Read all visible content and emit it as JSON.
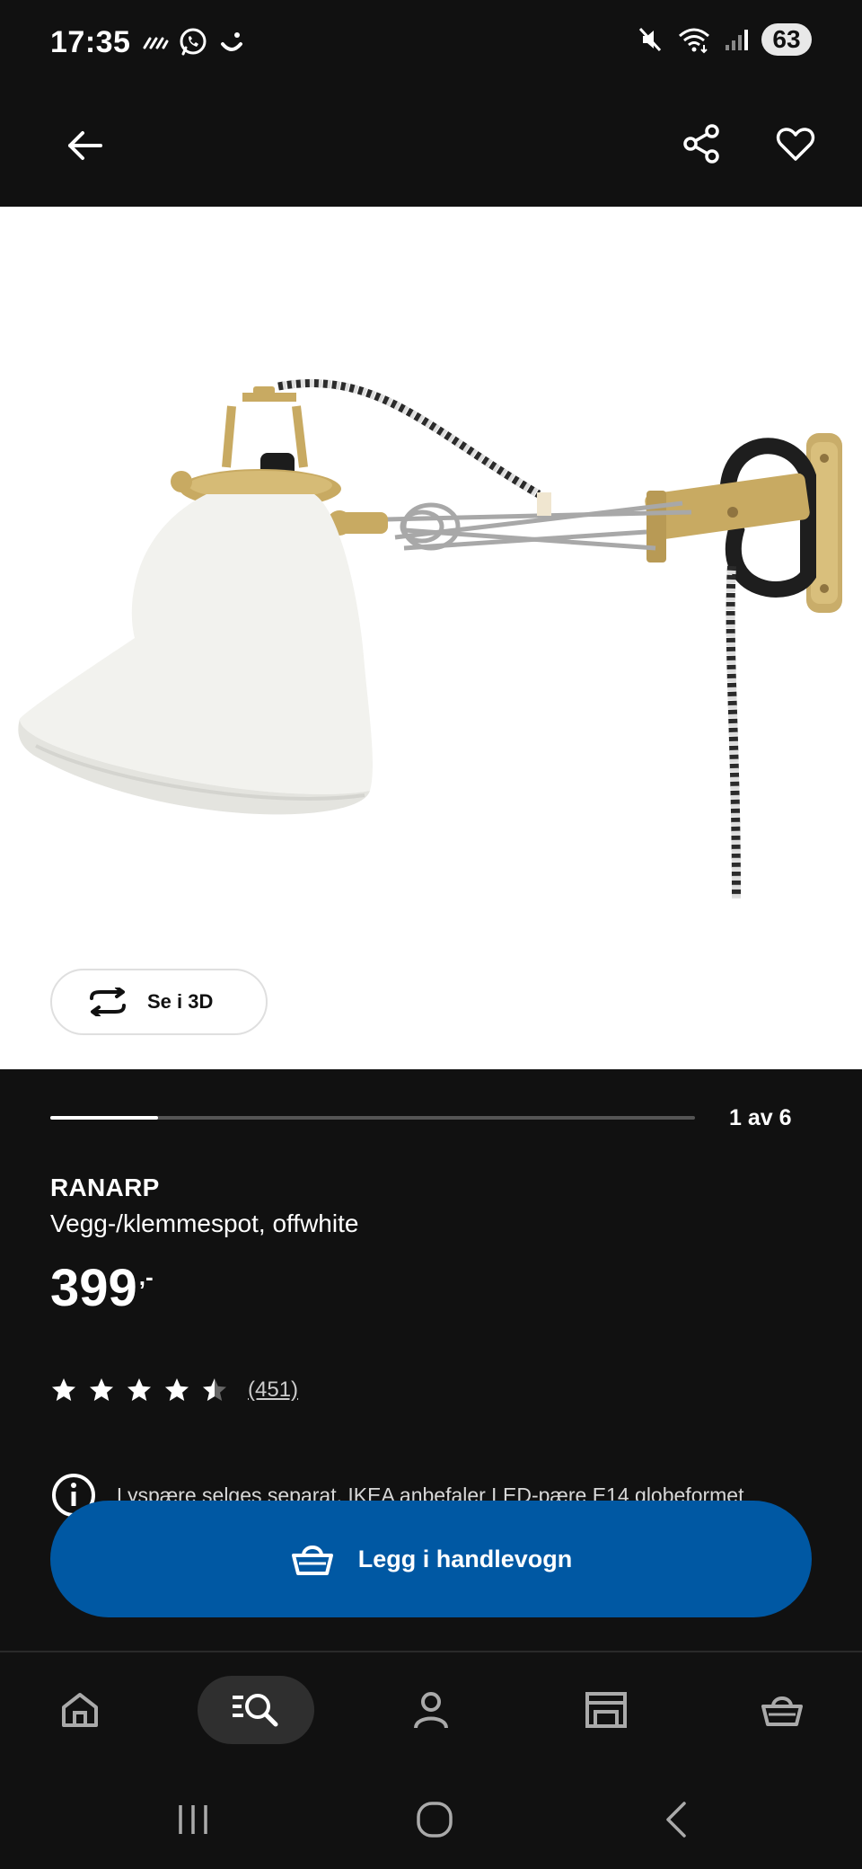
{
  "status_bar": {
    "time": "17:35",
    "battery": "63",
    "left_icons": [
      "signal-stream-icon",
      "whatsapp-icon",
      "smile-icon"
    ],
    "right_icons": [
      "mute-icon",
      "wifi-icon",
      "cell-signal-icon"
    ]
  },
  "app_bar": {
    "icons": [
      "back-arrow-icon",
      "share-icon",
      "heart-icon"
    ]
  },
  "gallery": {
    "view3d_label": "Se i 3D",
    "counter": "1 av 6",
    "progress_fraction": 0.1667
  },
  "product": {
    "name": "RANARP",
    "description": "Vegg-/klemmespot, offwhite",
    "price": "399",
    "price_suffix": ",-",
    "rating": 4.5,
    "rating_max": 5,
    "review_count": "(451)",
    "info_text": "Lyspære selges separat. IKEA anbefaler LED-pære E14 globeformet"
  },
  "cta": {
    "label": "Legg i handlevogn",
    "color": "#0058a3"
  },
  "bottom_nav": {
    "items": [
      "home-icon",
      "search-icon",
      "profile-icon",
      "store-icon",
      "cart-icon"
    ],
    "active": "search-icon"
  },
  "system_nav": {
    "items": [
      "recents-icon",
      "home-circle-icon",
      "back-chevron-icon"
    ]
  }
}
